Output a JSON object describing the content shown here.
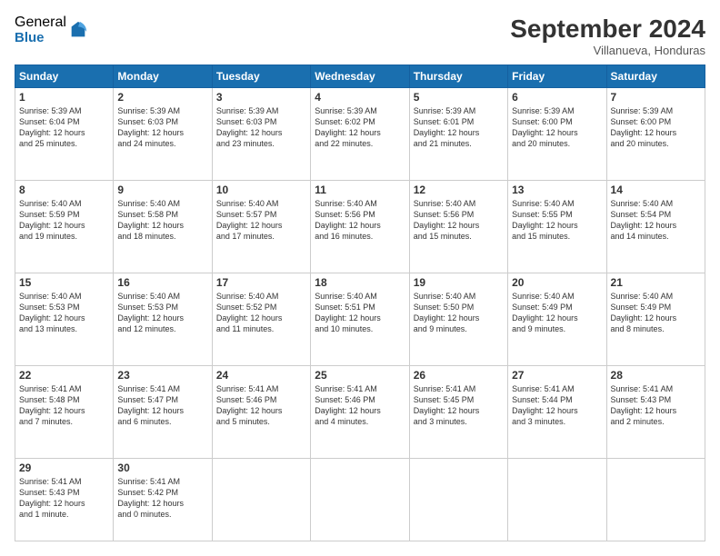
{
  "logo": {
    "general": "General",
    "blue": "Blue"
  },
  "header": {
    "month": "September 2024",
    "location": "Villanueva, Honduras"
  },
  "days": [
    "Sunday",
    "Monday",
    "Tuesday",
    "Wednesday",
    "Thursday",
    "Friday",
    "Saturday"
  ],
  "weeks": [
    [
      {
        "day": "1",
        "text": "Sunrise: 5:39 AM\nSunset: 6:04 PM\nDaylight: 12 hours\nand 25 minutes."
      },
      {
        "day": "2",
        "text": "Sunrise: 5:39 AM\nSunset: 6:03 PM\nDaylight: 12 hours\nand 24 minutes."
      },
      {
        "day": "3",
        "text": "Sunrise: 5:39 AM\nSunset: 6:03 PM\nDaylight: 12 hours\nand 23 minutes."
      },
      {
        "day": "4",
        "text": "Sunrise: 5:39 AM\nSunset: 6:02 PM\nDaylight: 12 hours\nand 22 minutes."
      },
      {
        "day": "5",
        "text": "Sunrise: 5:39 AM\nSunset: 6:01 PM\nDaylight: 12 hours\nand 21 minutes."
      },
      {
        "day": "6",
        "text": "Sunrise: 5:39 AM\nSunset: 6:00 PM\nDaylight: 12 hours\nand 20 minutes."
      },
      {
        "day": "7",
        "text": "Sunrise: 5:39 AM\nSunset: 6:00 PM\nDaylight: 12 hours\nand 20 minutes."
      }
    ],
    [
      {
        "day": "8",
        "text": "Sunrise: 5:40 AM\nSunset: 5:59 PM\nDaylight: 12 hours\nand 19 minutes."
      },
      {
        "day": "9",
        "text": "Sunrise: 5:40 AM\nSunset: 5:58 PM\nDaylight: 12 hours\nand 18 minutes."
      },
      {
        "day": "10",
        "text": "Sunrise: 5:40 AM\nSunset: 5:57 PM\nDaylight: 12 hours\nand 17 minutes."
      },
      {
        "day": "11",
        "text": "Sunrise: 5:40 AM\nSunset: 5:56 PM\nDaylight: 12 hours\nand 16 minutes."
      },
      {
        "day": "12",
        "text": "Sunrise: 5:40 AM\nSunset: 5:56 PM\nDaylight: 12 hours\nand 15 minutes."
      },
      {
        "day": "13",
        "text": "Sunrise: 5:40 AM\nSunset: 5:55 PM\nDaylight: 12 hours\nand 15 minutes."
      },
      {
        "day": "14",
        "text": "Sunrise: 5:40 AM\nSunset: 5:54 PM\nDaylight: 12 hours\nand 14 minutes."
      }
    ],
    [
      {
        "day": "15",
        "text": "Sunrise: 5:40 AM\nSunset: 5:53 PM\nDaylight: 12 hours\nand 13 minutes."
      },
      {
        "day": "16",
        "text": "Sunrise: 5:40 AM\nSunset: 5:53 PM\nDaylight: 12 hours\nand 12 minutes."
      },
      {
        "day": "17",
        "text": "Sunrise: 5:40 AM\nSunset: 5:52 PM\nDaylight: 12 hours\nand 11 minutes."
      },
      {
        "day": "18",
        "text": "Sunrise: 5:40 AM\nSunset: 5:51 PM\nDaylight: 12 hours\nand 10 minutes."
      },
      {
        "day": "19",
        "text": "Sunrise: 5:40 AM\nSunset: 5:50 PM\nDaylight: 12 hours\nand 9 minutes."
      },
      {
        "day": "20",
        "text": "Sunrise: 5:40 AM\nSunset: 5:49 PM\nDaylight: 12 hours\nand 9 minutes."
      },
      {
        "day": "21",
        "text": "Sunrise: 5:40 AM\nSunset: 5:49 PM\nDaylight: 12 hours\nand 8 minutes."
      }
    ],
    [
      {
        "day": "22",
        "text": "Sunrise: 5:41 AM\nSunset: 5:48 PM\nDaylight: 12 hours\nand 7 minutes."
      },
      {
        "day": "23",
        "text": "Sunrise: 5:41 AM\nSunset: 5:47 PM\nDaylight: 12 hours\nand 6 minutes."
      },
      {
        "day": "24",
        "text": "Sunrise: 5:41 AM\nSunset: 5:46 PM\nDaylight: 12 hours\nand 5 minutes."
      },
      {
        "day": "25",
        "text": "Sunrise: 5:41 AM\nSunset: 5:46 PM\nDaylight: 12 hours\nand 4 minutes."
      },
      {
        "day": "26",
        "text": "Sunrise: 5:41 AM\nSunset: 5:45 PM\nDaylight: 12 hours\nand 3 minutes."
      },
      {
        "day": "27",
        "text": "Sunrise: 5:41 AM\nSunset: 5:44 PM\nDaylight: 12 hours\nand 3 minutes."
      },
      {
        "day": "28",
        "text": "Sunrise: 5:41 AM\nSunset: 5:43 PM\nDaylight: 12 hours\nand 2 minutes."
      }
    ],
    [
      {
        "day": "29",
        "text": "Sunrise: 5:41 AM\nSunset: 5:43 PM\nDaylight: 12 hours\nand 1 minute."
      },
      {
        "day": "30",
        "text": "Sunrise: 5:41 AM\nSunset: 5:42 PM\nDaylight: 12 hours\nand 0 minutes."
      },
      {
        "day": "",
        "text": ""
      },
      {
        "day": "",
        "text": ""
      },
      {
        "day": "",
        "text": ""
      },
      {
        "day": "",
        "text": ""
      },
      {
        "day": "",
        "text": ""
      }
    ]
  ]
}
